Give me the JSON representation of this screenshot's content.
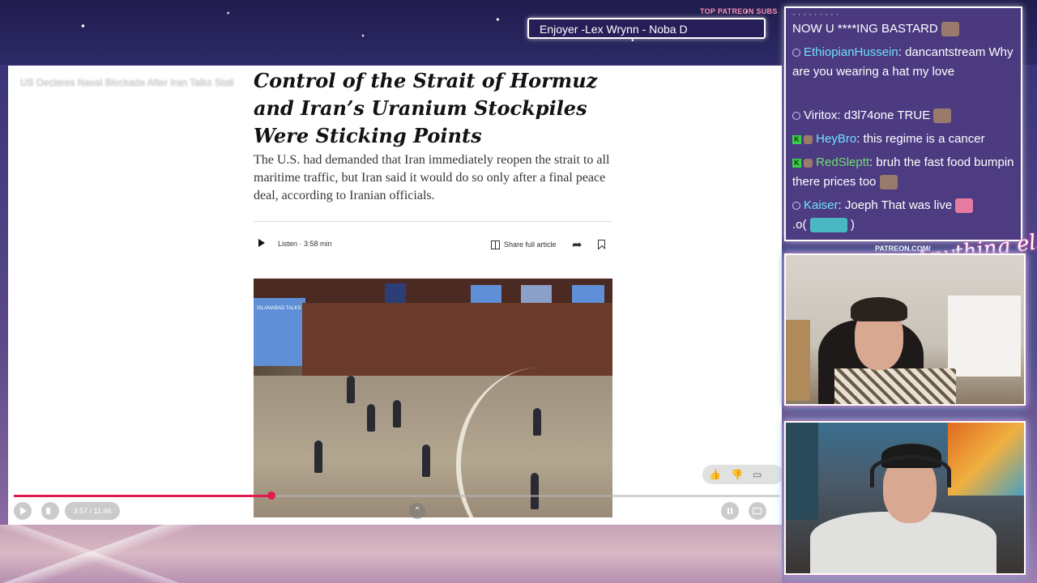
{
  "overlay": {
    "patreon_label": "TOP PATREON SUBS",
    "ticker_text": "Enjoyer -Lex Wrynn -  Noba D",
    "patreon_url": "PATREON.COM/",
    "brand_logo": "Anything else?"
  },
  "video": {
    "title": "US Declares Naval Blockade After Iran Talks Stall",
    "time": "3:57 / 11:46",
    "progress_fraction": 0.337
  },
  "article": {
    "headline": "Control of the Strait of Hormuz and Iran’s Uranium Stockpiles Were Sticking Points",
    "dek": "The U.S. had demanded that Iran immediately reopen the strait to all maritime traffic, but Iran said it would do so only after a final peace deal, according to Iranian officials.",
    "listen_label": "Listen · 3:58 min",
    "share_label": "Share full article",
    "photo_screen_text": "ISLAMABAD TALKS"
  },
  "chat": {
    "partial_top": "NOW U ****ING BASTARD",
    "messages": [
      {
        "user": "EthiopianHussein",
        "text": "dancantstream Why are you wearing a hat my love"
      },
      {
        "user": "Viritox",
        "text": "d3l74one TRUE"
      },
      {
        "user": "HeyBro",
        "text": "this regime is a cancer"
      },
      {
        "user": "RedSleptt",
        "text": "bruh the fast food bumpin there prices too"
      },
      {
        "user": "Kaiser",
        "text": "Joeph That was live"
      }
    ],
    "last_fragment": ".o(",
    "last_fragment_end": ")"
  },
  "colors": {
    "progress": "#e01a4f",
    "chat_bg": "#4e3c82",
    "username_cyan": "#6fe0ff",
    "username_green": "#6fe06a"
  }
}
